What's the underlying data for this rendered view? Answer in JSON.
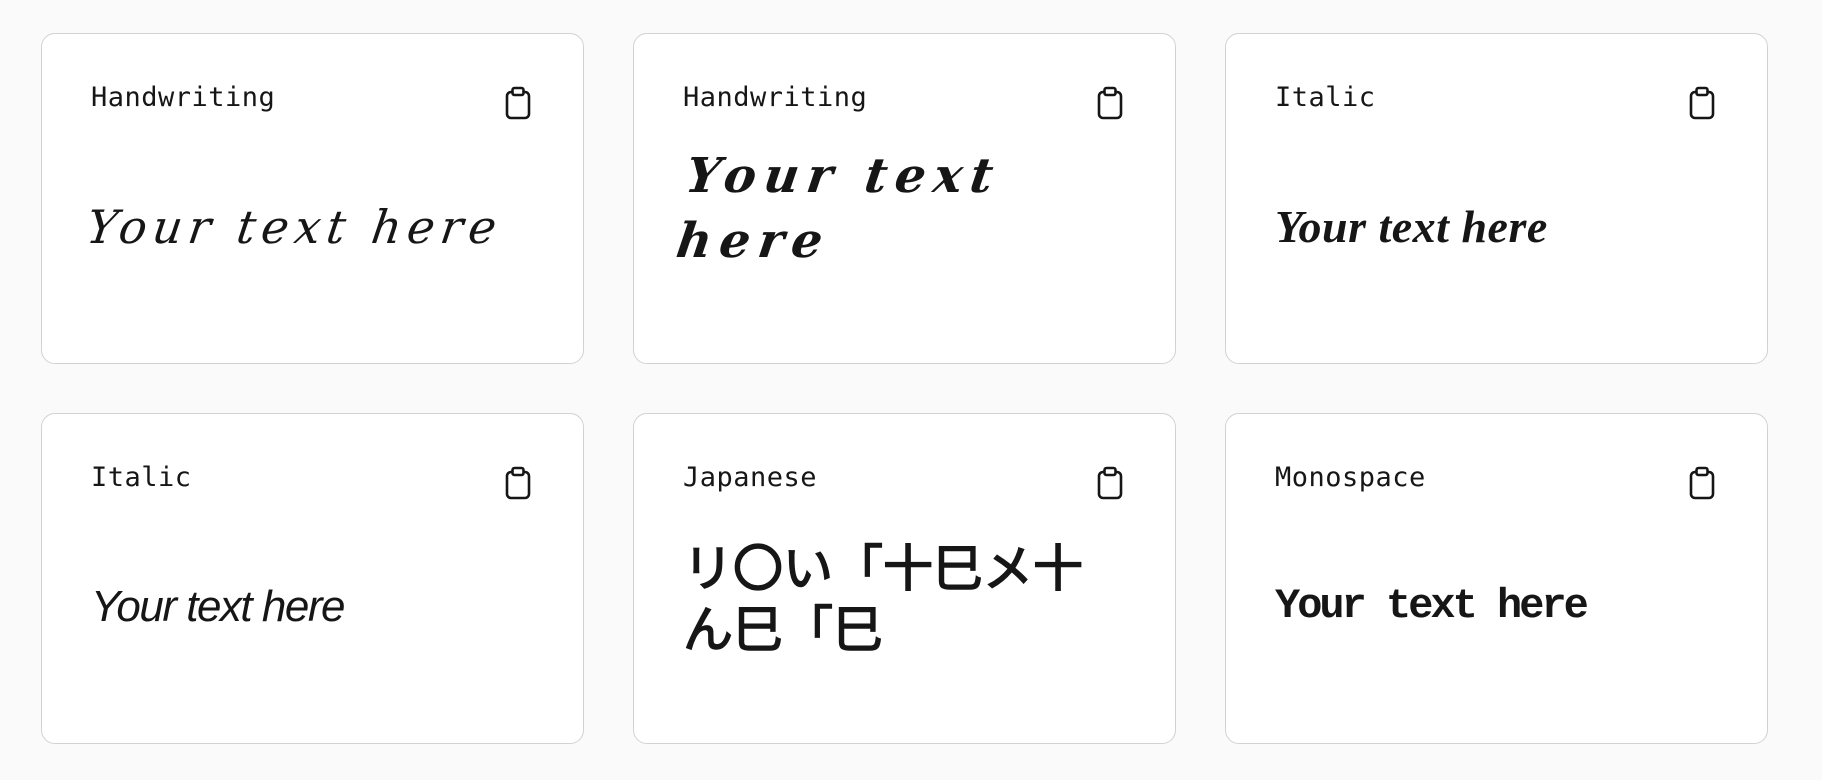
{
  "cards": [
    {
      "label": "Handwriting",
      "sample": "Your text here",
      "copy_icon": "clipboard-icon"
    },
    {
      "label": "Handwriting",
      "sample": "Your text here",
      "copy_icon": "clipboard-icon"
    },
    {
      "label": "Italic",
      "sample": "Your text here",
      "copy_icon": "clipboard-icon"
    },
    {
      "label": "Italic",
      "sample": "Your text here",
      "copy_icon": "clipboard-icon"
    },
    {
      "label": "Japanese",
      "sample": "リ〇い「十巳メ十ん巳「巳",
      "copy_icon": "clipboard-icon"
    },
    {
      "label": "Monospace",
      "sample": "Your text here",
      "copy_icon": "clipboard-icon"
    }
  ],
  "colors": {
    "page_background": "#fafafa",
    "card_background": "#ffffff",
    "card_border": "#d2d2d2",
    "text": "#161616"
  }
}
